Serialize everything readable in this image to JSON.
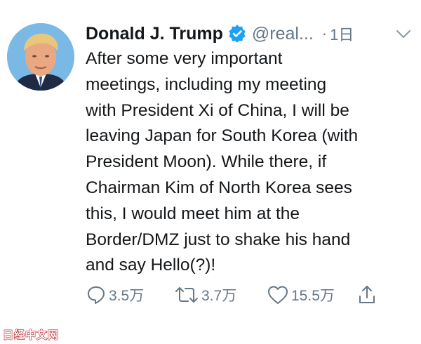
{
  "tweet": {
    "author_name": "Donald J. Trump",
    "handle": "@real...",
    "separator": "·",
    "timestamp": "1日",
    "text_lines": [
      "After some very important",
      "meetings, including my meeting",
      "with President Xi of China, I will be",
      "leaving Japan for South Korea (with",
      "President Moon). While there, if",
      "Chairman Kim of North Korea sees",
      "this, I would meet him at the",
      "Border/DMZ just to shake his hand",
      "and say Hello(?)!"
    ],
    "reply_count": "3.5万",
    "retweet_count": "3.7万",
    "like_count": "15.5万"
  },
  "icons": {
    "avatar": "profile-photo",
    "verified": "verified-badge-icon",
    "caret": "chevron-down-icon",
    "reply": "reply-icon",
    "retweet": "retweet-icon",
    "like": "heart-icon",
    "share": "share-icon"
  },
  "colors": {
    "text": "#14171a",
    "secondary": "#657786",
    "verified": "#1da1f2",
    "watermark": "#b0101a"
  },
  "watermark": "日经中文网"
}
